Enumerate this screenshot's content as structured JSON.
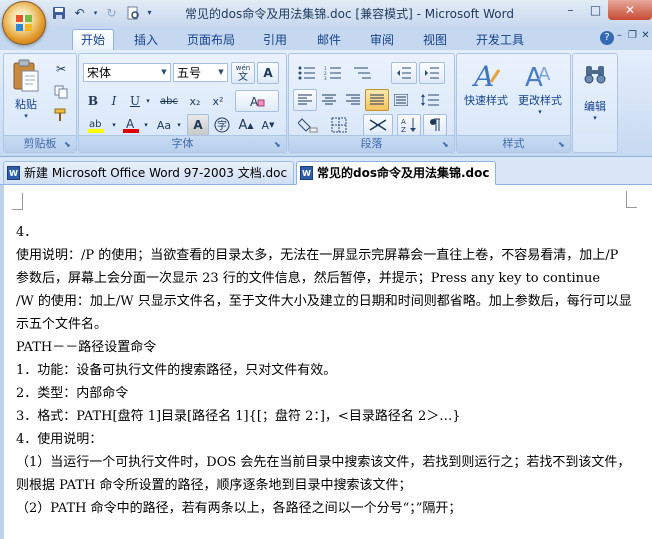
{
  "window": {
    "title": "常见的dos命令及用法集锦.doc [兼容模式] - Microsoft Word",
    "controls": {
      "minimize": "–",
      "maximize": "□",
      "close": "✕"
    }
  },
  "quick_access": [
    "save-icon",
    "undo-icon",
    "redo-icon",
    "print-preview-icon",
    "customize-icon"
  ],
  "tabs": [
    {
      "label": "开始",
      "active": true
    },
    {
      "label": "插入"
    },
    {
      "label": "页面布局"
    },
    {
      "label": "引用"
    },
    {
      "label": "邮件"
    },
    {
      "label": "审阅"
    },
    {
      "label": "视图"
    },
    {
      "label": "开发工具"
    }
  ],
  "ribbon": {
    "clipboard": {
      "label": "剪贴板",
      "paste": "粘贴"
    },
    "font": {
      "label": "字体",
      "font_name": "宋体",
      "font_size": "五号",
      "wen": "wén",
      "wen_char": "文",
      "a_box": "A",
      "bold": "B",
      "italic": "I",
      "underline": "U",
      "strike": "abc",
      "subscript": "x₂",
      "superscript": "x²",
      "aa": "Aa",
      "grow": "A",
      "shrink": "A"
    },
    "paragraph": {
      "label": "段落"
    },
    "styles": {
      "label": "样式",
      "quick_styles": "快速样式",
      "change_styles": "更改样式"
    },
    "editing": {
      "label": "编辑"
    }
  },
  "doc_tabs": [
    {
      "label": "新建 Microsoft Office Word 97-2003 文档.doc",
      "active": false
    },
    {
      "label": "常见的dos命令及用法集锦.doc",
      "active": true
    }
  ],
  "document": {
    "lines": [
      "4．",
      "使用说明：/P  的使用；当欲查看的目录太多，无法在一屏显示完屏幕会一直往上卷，不容易看清，加上/P 参数后，屏幕上会分面一次显示 23 行的文件信息，然后暂停，并提示；Press any key to continue",
      "/W 的使用：加上/W 只显示文件名，至于文件大小及建立的日期和时间则都省略。加上参数后，每行可以显示五个文件名。",
      "PATH－－路径设置命令",
      "1．功能：设备可执行文件的搜索路径，只对文件有效。",
      "2．类型：内部命令",
      "3．格式：PATH[盘符 1]目录[路径名 1]{[；盘符 2：]，<目录路径名 2＞…}",
      "4．使用说明：",
      "（1）当运行一个可执行文件时，DOS 会先在当前目录中搜索该文件，若找到则运行之；若找不到该文件，则根据 PATH 命令所设置的路径，顺序逐条地到目录中搜索该文件；",
      "（2）PATH 命令中的路径，若有两条以上，各路径之间以一个分号“；”隔开；"
    ]
  }
}
